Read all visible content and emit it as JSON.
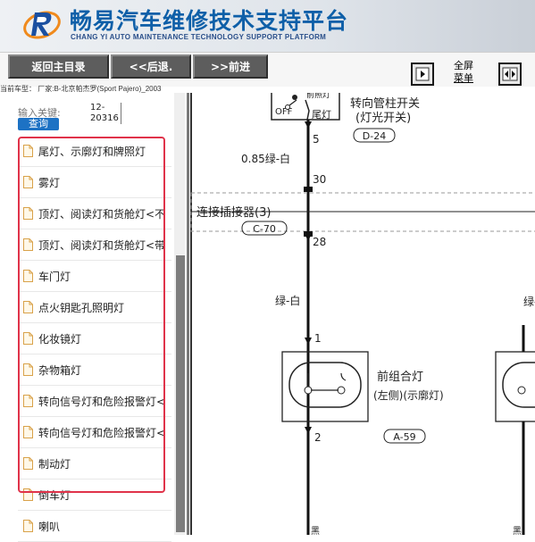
{
  "header": {
    "title_cn": "畅易汽车维修技术支持平台",
    "title_en": "CHANG YI AUTO MAINTENANCE TECHNOLOGY SUPPORT PLATFORM"
  },
  "toolbar": {
    "home_label": "返回主目录",
    "back_label": "<<后退.",
    "forward_label": ">>前进",
    "fullscreen_line1": "全屏",
    "fullscreen_line2": "菜单"
  },
  "vehicle_line": "当前车型：  厂家:B-北京帕杰罗(Sport Pajero)_2003",
  "search": {
    "label": "输入关键:",
    "value_line1": "12-",
    "value_line2": "20316",
    "button": "查询"
  },
  "sidebar": {
    "items": [
      {
        "label": "尾灯、示廓灯和牌照灯"
      },
      {
        "label": "雾灯"
      },
      {
        "label": "顶灯、阅读灯和货舱灯<不"
      },
      {
        "label": "顶灯、阅读灯和货舱灯<带"
      },
      {
        "label": "车门灯"
      },
      {
        "label": "点火钥匙孔照明灯"
      },
      {
        "label": "化妆镜灯"
      },
      {
        "label": "杂物箱灯"
      },
      {
        "label": "转向信号灯和危险报警灯<"
      },
      {
        "label": "转向信号灯和危险报警灯<"
      },
      {
        "label": "制动灯"
      },
      {
        "label": "倒车灯"
      },
      {
        "label": "喇叭"
      }
    ]
  },
  "diagram": {
    "switch_off": "OFF",
    "switch_partial": "前照灯",
    "switch_tail": "尾灯",
    "switch_name": "转向管柱开关",
    "switch_sub": "(灯光开关)",
    "pin_5": "5",
    "switch_code": "D-24",
    "wire_1": "0.85绿-白",
    "pin_30": "30",
    "connector_name": "连接插接器(3)",
    "connector_code": "C-70",
    "pin_28": "28",
    "wire_2": "绿-白",
    "pin_1": "1",
    "lamp_name": "前组合灯",
    "lamp_sub": "(左侧)(示廓灯)",
    "pin_2": "2",
    "lamp_code": "A-59",
    "bottom_a": "黑",
    "bottom_b": "黑"
  },
  "colors": {
    "brand_blue": "#0e5fa8",
    "highlight_red": "#e0334a",
    "button_gray": "#5d5d5d",
    "search_blue": "#1d72c4"
  }
}
